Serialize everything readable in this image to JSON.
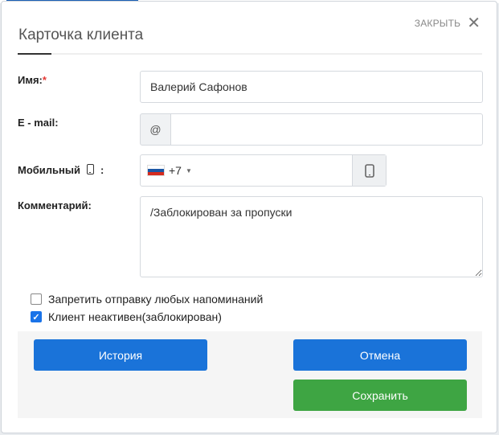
{
  "header": {
    "close_label": "ЗАКРЫТЬ",
    "title": "Карточка клиента"
  },
  "form": {
    "name": {
      "label": "Имя:",
      "required_mark": "*",
      "value": "Валерий Сафонов"
    },
    "email": {
      "label": "E - mail:",
      "addon": "@",
      "value": ""
    },
    "mobile": {
      "label": "Мобильный",
      "label_suffix": ":",
      "country_code": "+7",
      "value": ""
    },
    "comment": {
      "label": "Комментарий:",
      "value": "/Заблокирован за пропуски"
    }
  },
  "checkboxes": [
    {
      "label": "Запретить отправку любых напоминаний",
      "checked": false
    },
    {
      "label": "Клиент неактивен(заблокирован)",
      "checked": true
    }
  ],
  "buttons": {
    "history": "История",
    "cancel": "Отмена",
    "save": "Сохранить"
  },
  "colors": {
    "primary": "#1a73d9",
    "success": "#3ea543",
    "required": "#e53935"
  },
  "icons": {
    "close": "close-icon",
    "mobile": "mobile-phone-icon",
    "flag": "russia-flag-icon"
  }
}
